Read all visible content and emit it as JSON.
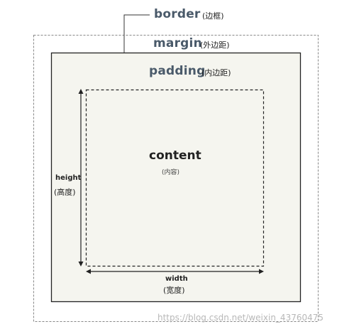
{
  "labels": {
    "border": "border",
    "border_note": "(边框)",
    "margin": "margin",
    "margin_note": "(外边距)",
    "padding": "padding",
    "padding_note": "(内边距)",
    "content": "content",
    "content_note": "(内容)",
    "height": "height",
    "height_note": "(高度)",
    "width": "width",
    "width_note": "(宽度)"
  },
  "watermark": "https://blog.csdn.net/weixin_43760475",
  "colors": {
    "padding_fill": "#f5f5ef",
    "border_stroke": "#222222",
    "margin_dash": "#888888",
    "content_dash": "#222222",
    "label_heading": "#4a5a6a"
  }
}
